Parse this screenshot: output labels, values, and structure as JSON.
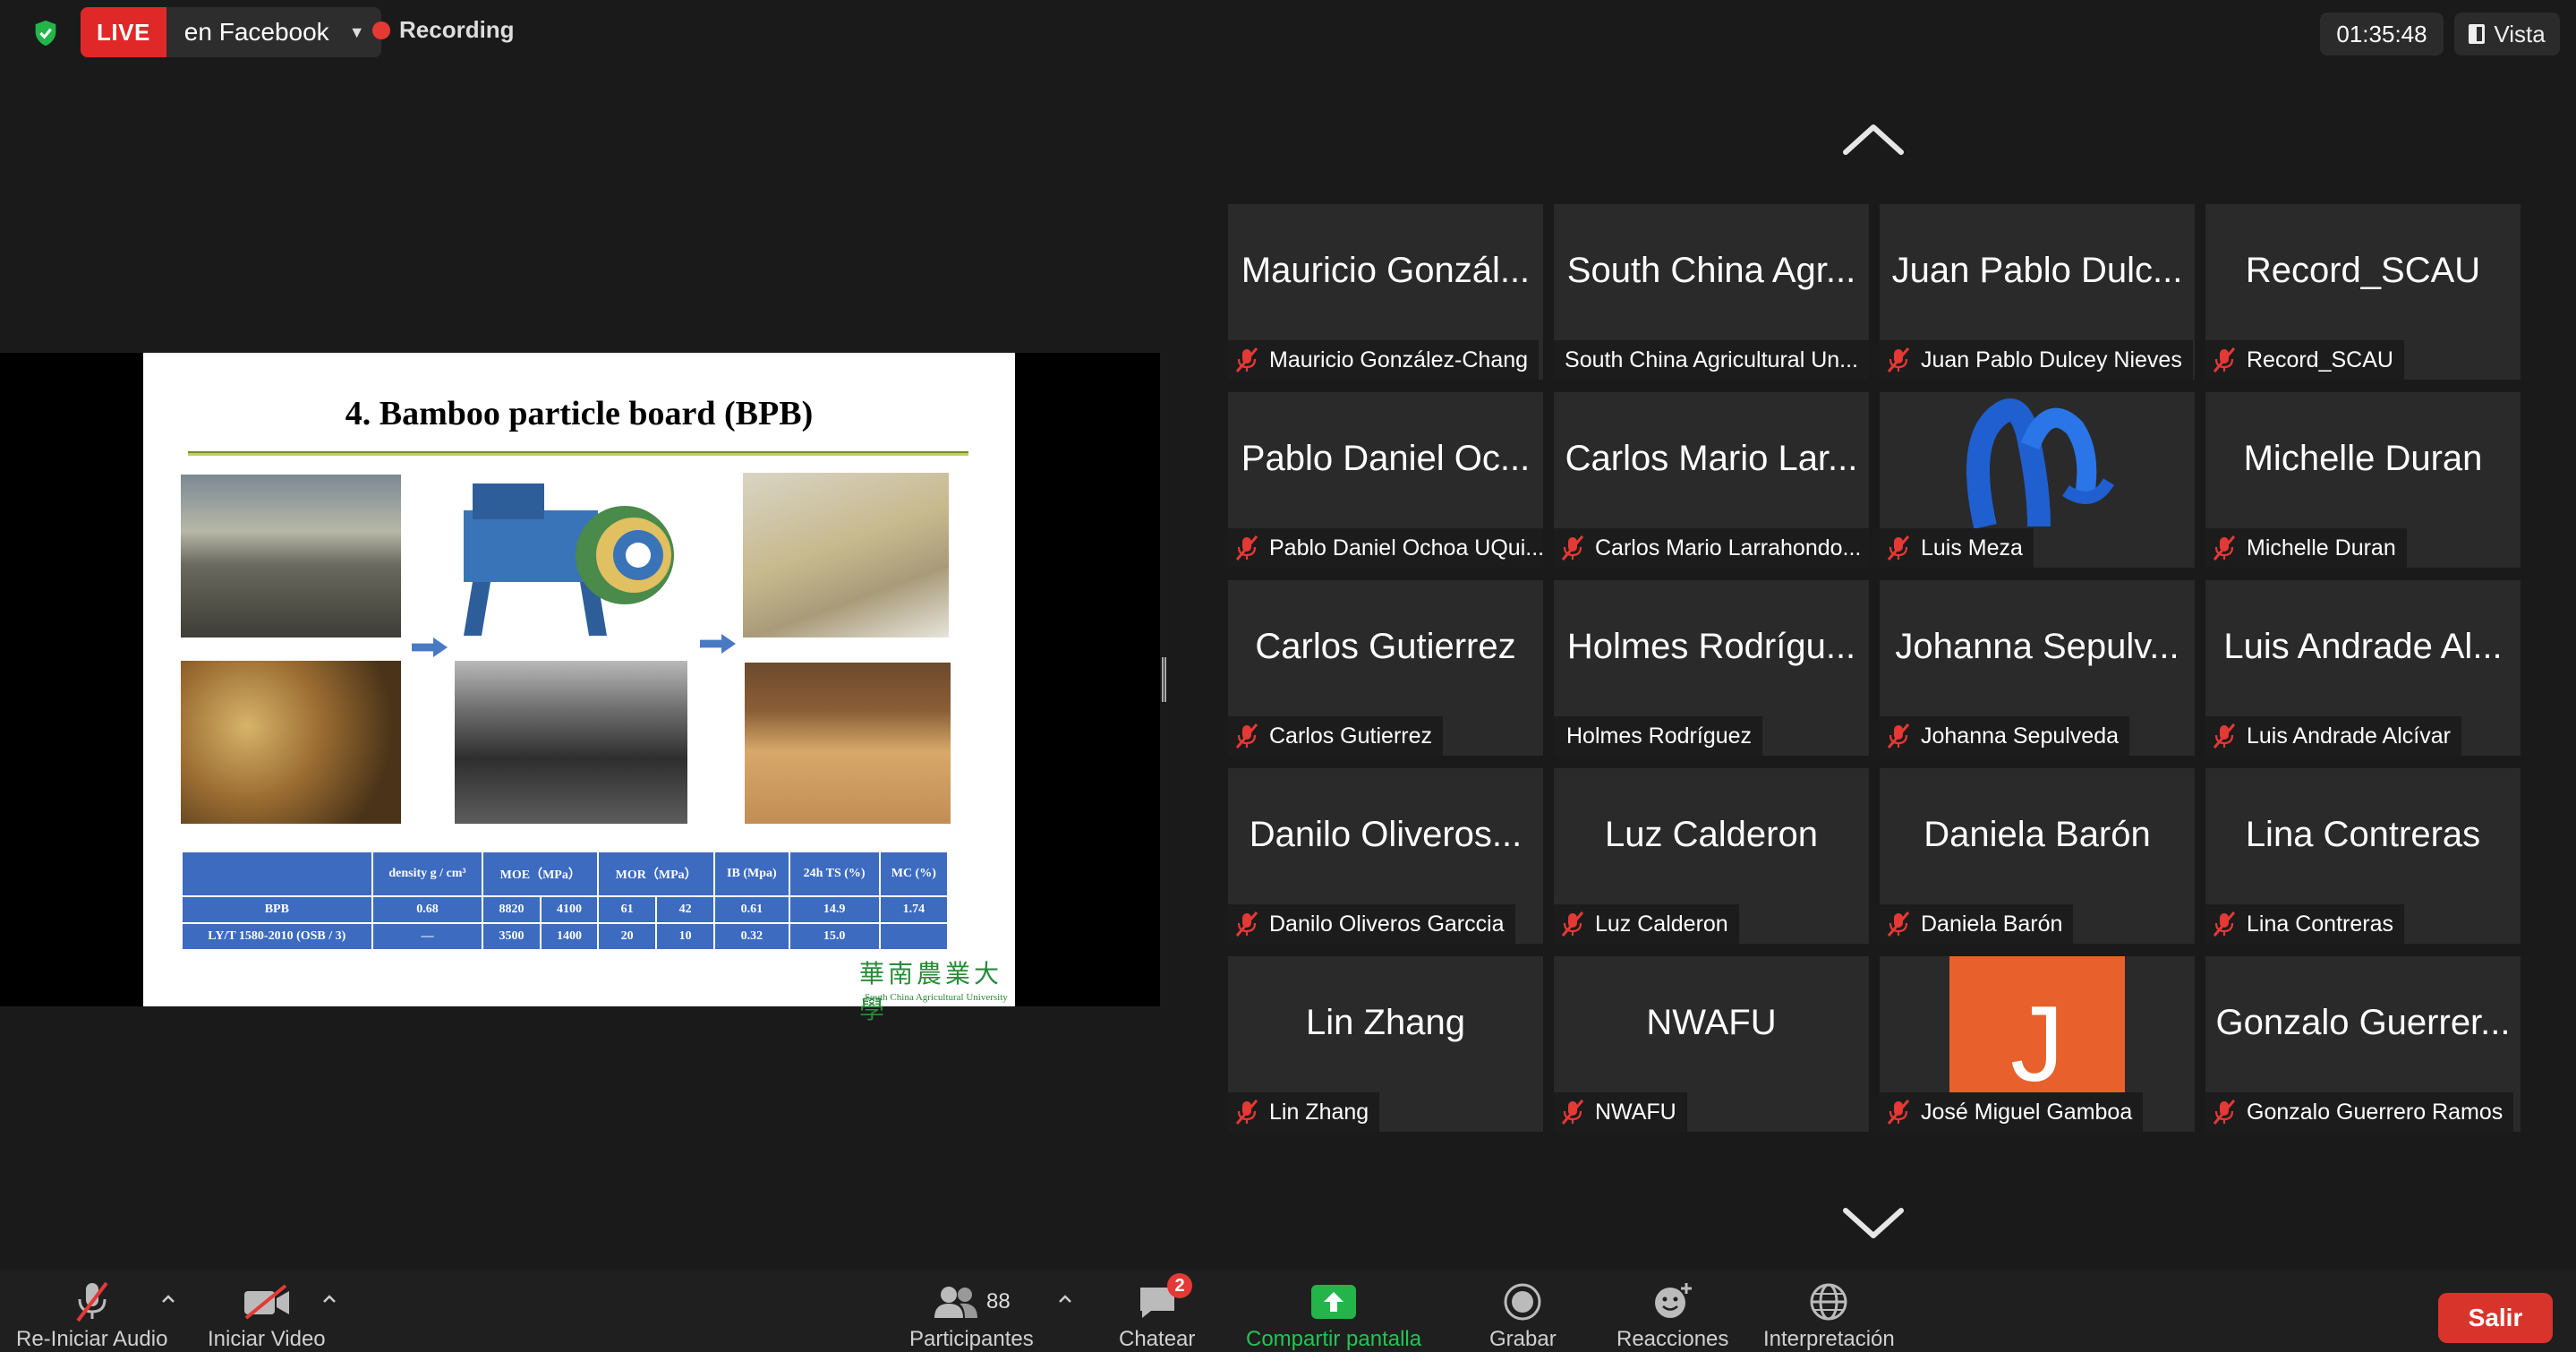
{
  "topbar": {
    "live_badge": "LIVE",
    "live_destination": "en Facebook",
    "recording_label": "Recording",
    "timer": "01:35:48",
    "view_label": "Vista"
  },
  "slide": {
    "title": "4. Bamboo particle board (BPB)",
    "table": {
      "headers": [
        "",
        "density g / cm³",
        "MOE（MPa）",
        "MOR（MPa）",
        "IB (Mpa)",
        "24h TS (%)",
        "MC (%)"
      ],
      "rows": [
        [
          "BPB",
          "0.68",
          "8820",
          "4100",
          "61",
          "42",
          "0.61",
          "14.9",
          "1.74"
        ],
        [
          "LY/T 1580-2010 (OSB / 3)",
          "—",
          "3500",
          "1400",
          "20",
          "10",
          "0.32",
          "15.0",
          ""
        ]
      ]
    },
    "logo_cn": "華南農業大學",
    "logo_en": "South China Agricultural University"
  },
  "gallery": [
    {
      "display": "Mauricio Gonzál...",
      "label": "Mauricio González-Chang",
      "muted": true
    },
    {
      "display": "South China Agr...",
      "label": "South China Agricultural Un...",
      "muted": false
    },
    {
      "display": "Juan Pablo Dulc...",
      "label": "Juan Pablo Dulcey Nieves",
      "muted": true
    },
    {
      "display": "Record_SCAU",
      "label": "Record_SCAU",
      "muted": true
    },
    {
      "display": "Pablo Daniel Oc...",
      "label": "Pablo Daniel Ochoa UQui...",
      "muted": true
    },
    {
      "display": "Carlos Mario Lar...",
      "label": "Carlos Mario Larrahondo...",
      "muted": true
    },
    {
      "display": "",
      "label": "Luis Meza",
      "muted": true,
      "avatar": "m-logo"
    },
    {
      "display": "Michelle Duran",
      "label": "Michelle Duran",
      "muted": true
    },
    {
      "display": "Carlos Gutierrez",
      "label": "Carlos Gutierrez",
      "muted": true
    },
    {
      "display": "Holmes Rodrígu...",
      "label": "Holmes Rodríguez",
      "muted": false
    },
    {
      "display": "Johanna  Sepulv...",
      "label": "Johanna  Sepulveda",
      "muted": true
    },
    {
      "display": "Luis Andrade Al...",
      "label": "Luis Andrade Alcívar",
      "muted": true
    },
    {
      "display": "Danilo Oliveros...",
      "label": "Danilo Oliveros Garccia",
      "muted": true
    },
    {
      "display": "Luz Calderon",
      "label": "Luz Calderon",
      "muted": true
    },
    {
      "display": "Daniela Barón",
      "label": "Daniela Barón",
      "muted": true
    },
    {
      "display": "Lina Contreras",
      "label": "Lina Contreras",
      "muted": true
    },
    {
      "display": "Lin Zhang",
      "label": "Lin Zhang",
      "muted": true
    },
    {
      "display": "NWAFU",
      "label": "NWAFU",
      "muted": true
    },
    {
      "display": "J",
      "label": "José Miguel Gamboa",
      "muted": true,
      "avatar": "letter-j"
    },
    {
      "display": "Gonzalo Guerrer...",
      "label": "Gonzalo Guerrero Ramos",
      "muted": true
    }
  ],
  "toolbar": {
    "audio": "Re-Iniciar Audio",
    "video": "Iniciar Video",
    "participants": "Participantes",
    "participants_count": "88",
    "chat": "Chatear",
    "chat_badge": "2",
    "share": "Compartir pantalla",
    "record": "Grabar",
    "reactions": "Reacciones",
    "interpretation": "Interpretación",
    "exit": "Salir"
  },
  "colors": {
    "live": "#e02828",
    "share_green": "#23b54a",
    "exit_red": "#d9342b",
    "avatar_orange": "#e8602c",
    "slide_table_blue": "#3c6bc0"
  }
}
